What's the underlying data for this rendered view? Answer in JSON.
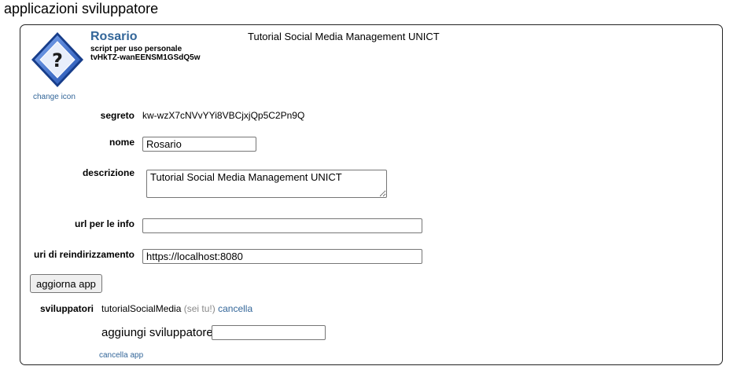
{
  "page": {
    "title": "applicazioni sviluppatore"
  },
  "app": {
    "icon": "help-question-icon",
    "change_icon_label": "change icon",
    "name": "Rosario",
    "type": "script per uso personale",
    "client_id": "tvHkTZ-wanEENSM1GSdQ5w",
    "description_header": "Tutorial Social Media Management UNICT"
  },
  "form": {
    "secret_label": "segreto",
    "secret_value": "kw-wzX7cNVvYYi8VBCjxjQp5C2Pn9Q",
    "name_label": "nome",
    "name_value": "Rosario",
    "description_label": "descrizione",
    "description_value": "Tutorial Social Media Management UNICT",
    "about_url_label": "url per le info",
    "about_url_value": "",
    "redirect_uri_label": "uri di reindirizzamento",
    "redirect_uri_value": "https://localhost:8080",
    "update_button": "aggiorna app"
  },
  "developers": {
    "label": "sviluppatori",
    "name": "tutorialSocialMedia",
    "you_note": "(sei tu!)",
    "remove_label": "cancella",
    "add_label": "aggiungi sviluppatore:",
    "add_value": ""
  },
  "delete_app_label": "cancella app",
  "colors": {
    "link": "#336699",
    "icon_blue": "#3a6fd6",
    "border": "#222222"
  }
}
